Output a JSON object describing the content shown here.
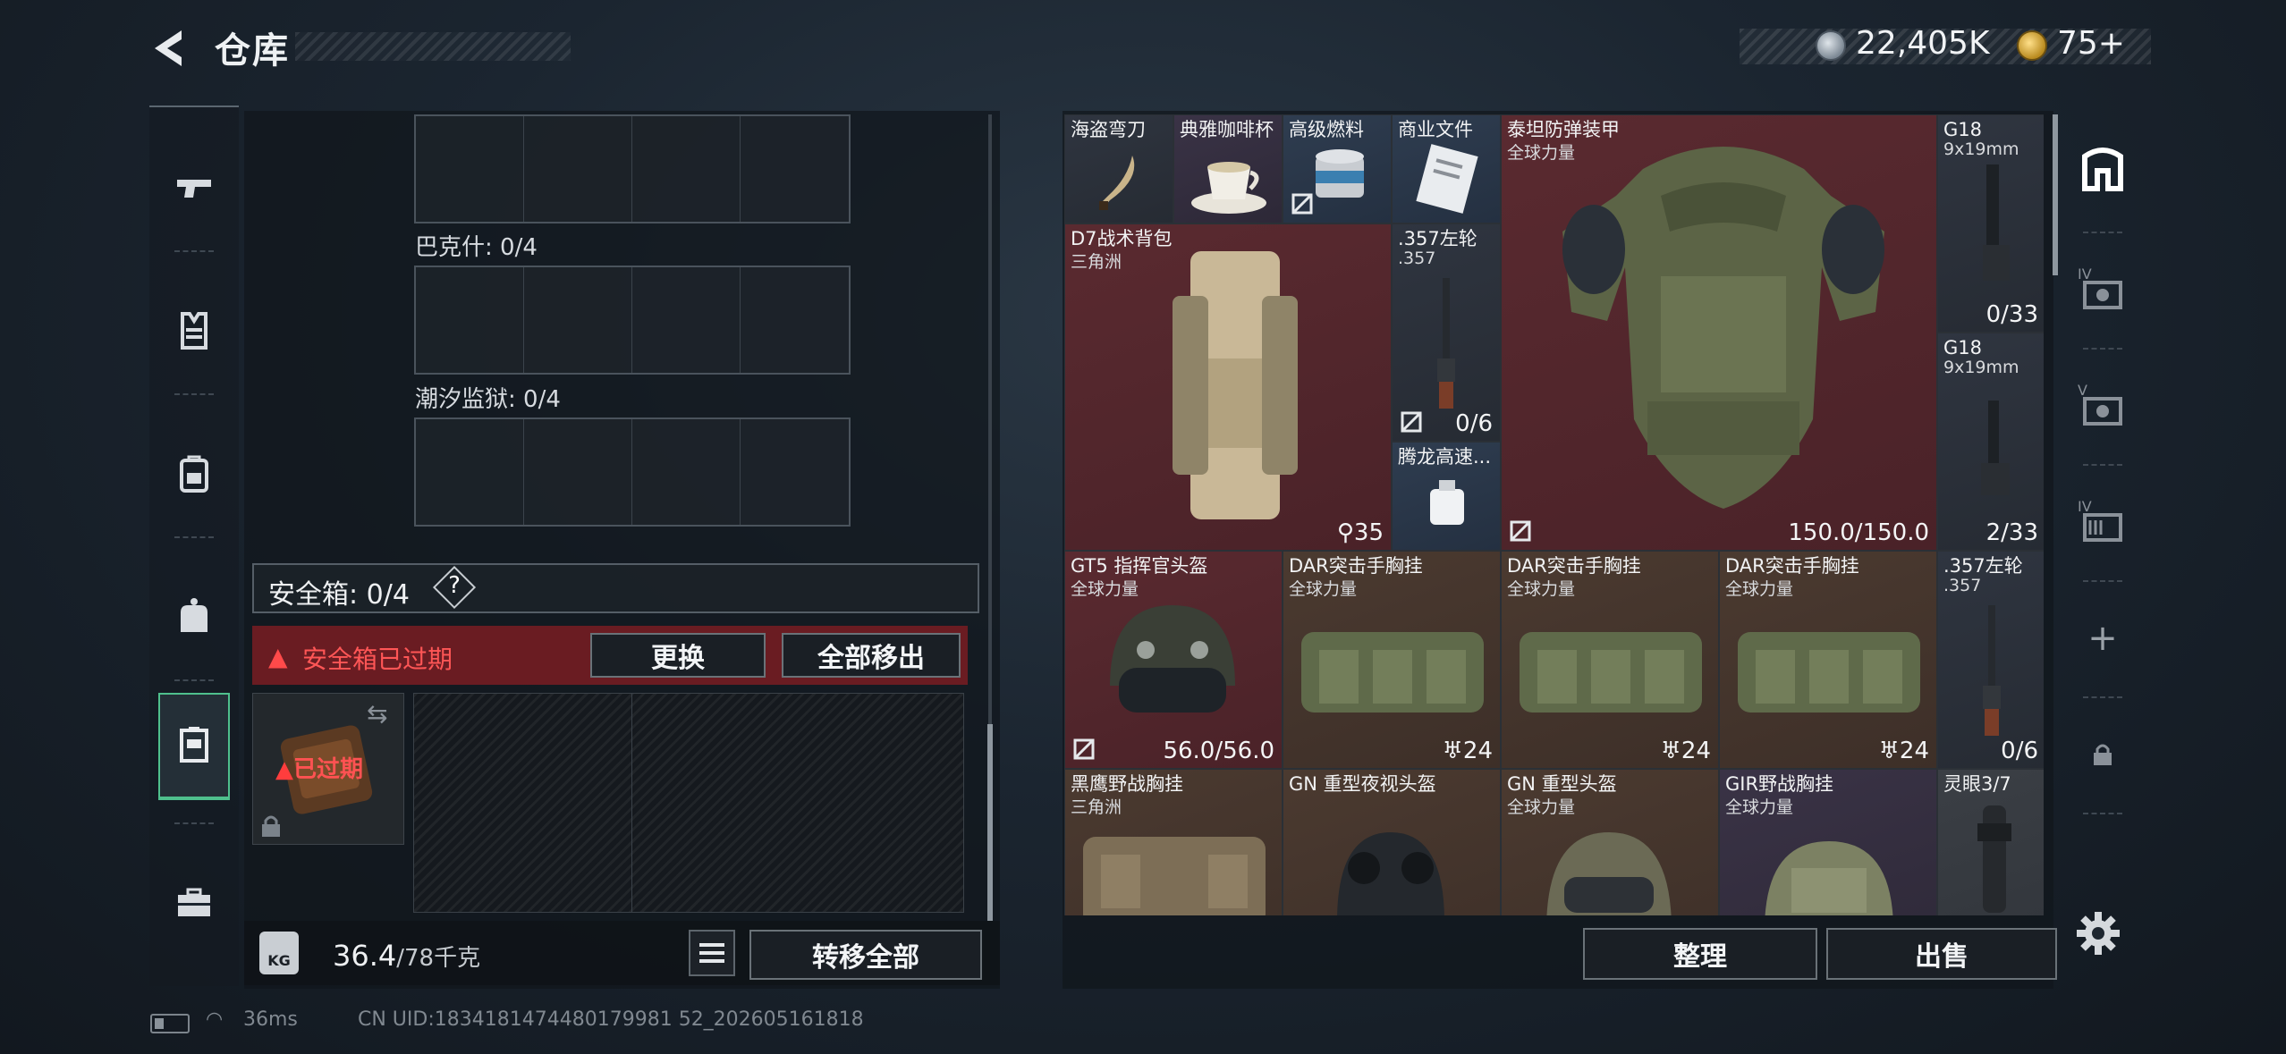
{
  "header": {
    "title": "仓库",
    "currency_main": "22,405K",
    "currency_secondary": "75+"
  },
  "left_rail": {
    "categories": [
      "weapons",
      "armor",
      "backpack",
      "chest-rig",
      "safebox",
      "toolbox"
    ]
  },
  "stash": {
    "grids": [
      {
        "label": ""
      },
      {
        "label": "巴克什: 0/4"
      },
      {
        "label": "潮汐监狱: 0/4"
      }
    ],
    "safebox_label": "安全箱: 0/4",
    "help": "?",
    "expired_notice": "安全箱已过期",
    "replace_button": "更换",
    "move_all_out_button": "全部移出",
    "box_expired_tag": "已过期",
    "weight_value": "36.4",
    "weight_unit": "/78千克",
    "kg_label": "KG",
    "transfer_all_button": "转移全部"
  },
  "inventory": {
    "items": [
      {
        "name": "海盗弯刀",
        "sub": "",
        "count": ""
      },
      {
        "name": "典雅咖啡杯",
        "sub": "",
        "count": ""
      },
      {
        "name": "高级燃料",
        "sub": "",
        "count": ""
      },
      {
        "name": "商业文件",
        "sub": "",
        "count": ""
      },
      {
        "name": "泰坦防弹装甲",
        "sub": "全球力量",
        "count": "150.0/150.0"
      },
      {
        "name": "G18",
        "sub": "9x19mm",
        "count": "0/33"
      },
      {
        "name": "D7战术背包",
        "sub": "三角洲",
        "count": "35"
      },
      {
        "name": ".357左轮",
        "sub": ".357",
        "count": "0/6"
      },
      {
        "name": "G18",
        "sub": "9x19mm",
        "count": "2/33"
      },
      {
        "name": "腾龙高速...",
        "sub": "",
        "count": ""
      },
      {
        "name": "GT5 指挥官头盔",
        "sub": "全球力量",
        "count": "56.0/56.0"
      },
      {
        "name": "DAR突击手胸挂",
        "sub": "全球力量",
        "count": "24"
      },
      {
        "name": "DAR突击手胸挂",
        "sub": "全球力量",
        "count": "24"
      },
      {
        "name": "DAR突击手胸挂",
        "sub": "全球力量",
        "count": "24"
      },
      {
        "name": ".357左轮",
        "sub": ".357",
        "count": "0/6"
      },
      {
        "name": "黑鹰野战胸挂",
        "sub": "三角洲",
        "count": ""
      },
      {
        "name": "GN 重型夜视头盔",
        "sub": "",
        "count": ""
      },
      {
        "name": "GN 重型头盔",
        "sub": "全球力量",
        "count": ""
      },
      {
        "name": "GIR野战胸挂",
        "sub": "全球力量",
        "count": ""
      },
      {
        "name": "灵眼3/7",
        "sub": "",
        "count": ""
      }
    ],
    "sort_button": "整理",
    "sell_button": "出售"
  },
  "right_rail": {
    "badges": [
      "IV",
      "V",
      "IV"
    ],
    "add": "+"
  },
  "status_bar": {
    "ping": "36ms",
    "uid": "CN UID:1834181474480179981 52_202605161818"
  },
  "colors": {
    "accent_green": "#4fc08d",
    "danger_red": "#ff5656",
    "rarity_red": "#5a2a30",
    "rarity_brown": "#4b3a30",
    "rarity_purple": "#3a3346",
    "rarity_blue": "#2f3d50"
  }
}
